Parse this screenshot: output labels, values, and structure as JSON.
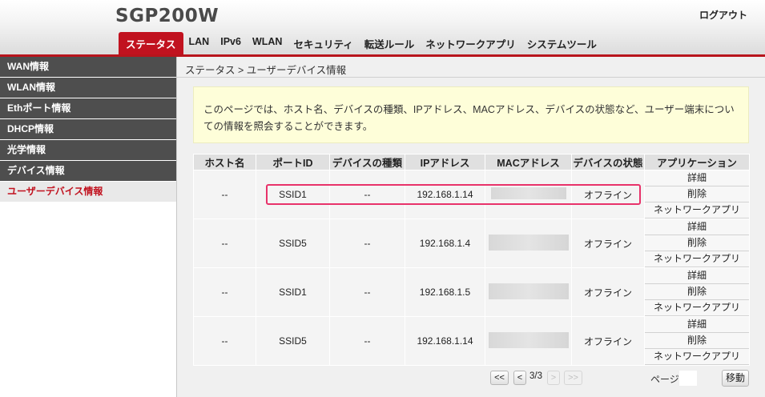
{
  "header": {
    "brand": "SGP200W",
    "logout": "ログアウト",
    "tabs": [
      {
        "label": "ステータス",
        "active": true
      },
      {
        "label": "LAN"
      },
      {
        "label": "IPv6"
      },
      {
        "label": "WLAN"
      },
      {
        "label": "セキュリティ"
      },
      {
        "label": "転送ルール"
      },
      {
        "label": "ネットワークアプリ"
      },
      {
        "label": "システムツール"
      }
    ]
  },
  "sidebar": {
    "items": [
      {
        "label": "WAN情報"
      },
      {
        "label": "WLAN情報"
      },
      {
        "label": "Ethポート情報"
      },
      {
        "label": "DHCP情報"
      },
      {
        "label": "光学情報"
      },
      {
        "label": "デバイス情報"
      },
      {
        "label": "ユーザーデバイス情報",
        "active": true
      }
    ]
  },
  "main": {
    "breadcrumb": "ステータス > ユーザーデバイス情報",
    "info_text": "このページでは、ホスト名、デバイスの種類、IPアドレス、MACアドレス、デバイスの状態など、ユーザー端末についての情報を照会することができます。",
    "table": {
      "headers": [
        "ホスト名",
        "ポートID",
        "デバイスの種類",
        "IPアドレス",
        "MACアドレス",
        "デバイスの状態",
        "アプリケーション"
      ],
      "rows": [
        {
          "host": "--",
          "port": "SSID1",
          "type": "--",
          "ip": "192.168.1.14",
          "status": "オフライン"
        },
        {
          "host": "--",
          "port": "SSID5",
          "type": "--",
          "ip": "192.168.1.4",
          "status": "オフライン"
        },
        {
          "host": "--",
          "port": "SSID1",
          "type": "--",
          "ip": "192.168.1.5",
          "status": "オフライン"
        },
        {
          "host": "--",
          "port": "SSID5",
          "type": "--",
          "ip": "192.168.1.14",
          "status": "オフライン"
        }
      ],
      "actions": {
        "detail": "詳細",
        "delete": "削除",
        "netapp": "ネットワークアプリ"
      }
    },
    "pagination": {
      "first": "<<",
      "prev": "<",
      "status": "3/3",
      "next": ">",
      "last": ">>",
      "page_label": "ページ",
      "page_value": "",
      "move": "移動"
    }
  },
  "colors": {
    "accent": "#c1121f",
    "highlight": "#e8326a",
    "sidebar_bg": "#4e4e4e"
  }
}
